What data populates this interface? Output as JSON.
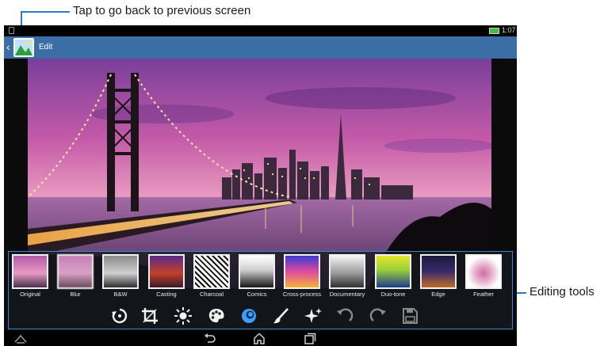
{
  "callouts": {
    "back": "Tap to go back to previous screen",
    "tools": "Editing tools"
  },
  "status_bar": {
    "time": "1:07"
  },
  "action_bar": {
    "title": "Edit"
  },
  "effects": [
    {
      "label": "Original"
    },
    {
      "label": "Blur"
    },
    {
      "label": "B&W"
    },
    {
      "label": "Casting"
    },
    {
      "label": "Charcoal"
    },
    {
      "label": "Comics"
    },
    {
      "label": "Cross-process"
    },
    {
      "label": "Documentary"
    },
    {
      "label": "Duo-tone"
    },
    {
      "label": "Edge"
    },
    {
      "label": "Feather"
    }
  ],
  "tools": [
    {
      "name": "rotate-tool-icon"
    },
    {
      "name": "crop-tool-icon"
    },
    {
      "name": "brightness-tool-icon"
    },
    {
      "name": "color-palette-tool-icon"
    },
    {
      "name": "effects-tool-icon"
    },
    {
      "name": "brush-tool-icon"
    },
    {
      "name": "sparkle-tool-icon"
    },
    {
      "name": "undo-icon"
    },
    {
      "name": "redo-icon"
    },
    {
      "name": "save-icon"
    }
  ],
  "colors": {
    "action_bar": "#3c6ea6",
    "highlight_frame": "#3a86d0",
    "active_tool": "#3aa0ff",
    "battery": "#3fbf3f"
  }
}
